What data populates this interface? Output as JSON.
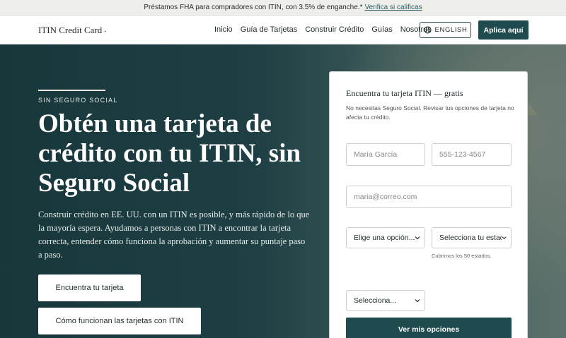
{
  "announcement": {
    "text": "Préstamos FHA para compradores con ITIN, con 3.5% de enganche.*",
    "link": "Verifica si calificas"
  },
  "nav": {
    "brand": "ITIN Credit Card",
    "brand_mark": ".",
    "items": [
      "Inicio",
      "Guía de Tarjetas",
      "Construir Crédito",
      "Guías",
      "Nosotros"
    ],
    "language_button": "ENGLISH",
    "cta": "Aplica aquí"
  },
  "hero": {
    "kicker": "SIN SEGURO SOCIAL",
    "headline": "Obtén una tarjeta de crédito con tu ITIN, sin Seguro Social",
    "body": "Construir crédito en EE. UU. con un ITIN es posible, y más rápido de lo que la mayoría espera. Ayudamos a personas con ITIN a encontrar la tarjeta correcta, entender cómo funciona la aprobación y aumentar su puntaje paso a paso.",
    "primary_button": "Encuentra tu tarjeta",
    "secondary_button": "Cómo funcionan las tarjetas con ITIN"
  },
  "form": {
    "title": "Encuentra tu tarjeta ITIN — gratis",
    "subtitle": "No necesitas Seguro Social. Revisar tus opciones de tarjeta no afecta tu crédito.",
    "name_placeholder": "María García",
    "phone_placeholder": "555-123-4567",
    "email_placeholder": "maria@correo.com",
    "select1": "Elige una opción...",
    "select2": "Selecciona tu estado",
    "select2_note": "Cubrimos los 50 estados.",
    "select3": "Selecciona...",
    "submit": "Ver mis opciones"
  },
  "colors": {
    "primary": "#1f4a4e",
    "hero_bg": "#17373b",
    "announcement_bg": "#eeeeea"
  }
}
